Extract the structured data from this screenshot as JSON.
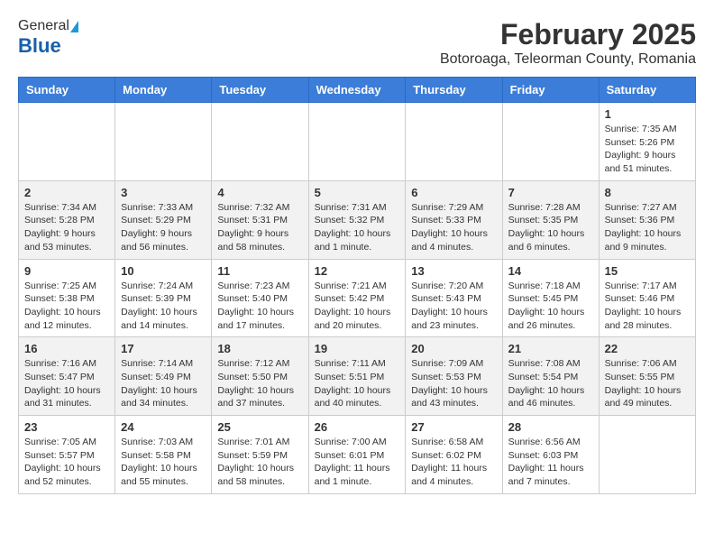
{
  "header": {
    "logo_general": "General",
    "logo_blue": "Blue",
    "main_title": "February 2025",
    "subtitle": "Botoroaga, Teleorman County, Romania"
  },
  "calendar": {
    "days_of_week": [
      "Sunday",
      "Monday",
      "Tuesday",
      "Wednesday",
      "Thursday",
      "Friday",
      "Saturday"
    ],
    "weeks": [
      [
        {
          "day": "",
          "info": ""
        },
        {
          "day": "",
          "info": ""
        },
        {
          "day": "",
          "info": ""
        },
        {
          "day": "",
          "info": ""
        },
        {
          "day": "",
          "info": ""
        },
        {
          "day": "",
          "info": ""
        },
        {
          "day": "1",
          "info": "Sunrise: 7:35 AM\nSunset: 5:26 PM\nDaylight: 9 hours\nand 51 minutes."
        }
      ],
      [
        {
          "day": "2",
          "info": "Sunrise: 7:34 AM\nSunset: 5:28 PM\nDaylight: 9 hours\nand 53 minutes."
        },
        {
          "day": "3",
          "info": "Sunrise: 7:33 AM\nSunset: 5:29 PM\nDaylight: 9 hours\nand 56 minutes."
        },
        {
          "day": "4",
          "info": "Sunrise: 7:32 AM\nSunset: 5:31 PM\nDaylight: 9 hours\nand 58 minutes."
        },
        {
          "day": "5",
          "info": "Sunrise: 7:31 AM\nSunset: 5:32 PM\nDaylight: 10 hours\nand 1 minute."
        },
        {
          "day": "6",
          "info": "Sunrise: 7:29 AM\nSunset: 5:33 PM\nDaylight: 10 hours\nand 4 minutes."
        },
        {
          "day": "7",
          "info": "Sunrise: 7:28 AM\nSunset: 5:35 PM\nDaylight: 10 hours\nand 6 minutes."
        },
        {
          "day": "8",
          "info": "Sunrise: 7:27 AM\nSunset: 5:36 PM\nDaylight: 10 hours\nand 9 minutes."
        }
      ],
      [
        {
          "day": "9",
          "info": "Sunrise: 7:25 AM\nSunset: 5:38 PM\nDaylight: 10 hours\nand 12 minutes."
        },
        {
          "day": "10",
          "info": "Sunrise: 7:24 AM\nSunset: 5:39 PM\nDaylight: 10 hours\nand 14 minutes."
        },
        {
          "day": "11",
          "info": "Sunrise: 7:23 AM\nSunset: 5:40 PM\nDaylight: 10 hours\nand 17 minutes."
        },
        {
          "day": "12",
          "info": "Sunrise: 7:21 AM\nSunset: 5:42 PM\nDaylight: 10 hours\nand 20 minutes."
        },
        {
          "day": "13",
          "info": "Sunrise: 7:20 AM\nSunset: 5:43 PM\nDaylight: 10 hours\nand 23 minutes."
        },
        {
          "day": "14",
          "info": "Sunrise: 7:18 AM\nSunset: 5:45 PM\nDaylight: 10 hours\nand 26 minutes."
        },
        {
          "day": "15",
          "info": "Sunrise: 7:17 AM\nSunset: 5:46 PM\nDaylight: 10 hours\nand 28 minutes."
        }
      ],
      [
        {
          "day": "16",
          "info": "Sunrise: 7:16 AM\nSunset: 5:47 PM\nDaylight: 10 hours\nand 31 minutes."
        },
        {
          "day": "17",
          "info": "Sunrise: 7:14 AM\nSunset: 5:49 PM\nDaylight: 10 hours\nand 34 minutes."
        },
        {
          "day": "18",
          "info": "Sunrise: 7:12 AM\nSunset: 5:50 PM\nDaylight: 10 hours\nand 37 minutes."
        },
        {
          "day": "19",
          "info": "Sunrise: 7:11 AM\nSunset: 5:51 PM\nDaylight: 10 hours\nand 40 minutes."
        },
        {
          "day": "20",
          "info": "Sunrise: 7:09 AM\nSunset: 5:53 PM\nDaylight: 10 hours\nand 43 minutes."
        },
        {
          "day": "21",
          "info": "Sunrise: 7:08 AM\nSunset: 5:54 PM\nDaylight: 10 hours\nand 46 minutes."
        },
        {
          "day": "22",
          "info": "Sunrise: 7:06 AM\nSunset: 5:55 PM\nDaylight: 10 hours\nand 49 minutes."
        }
      ],
      [
        {
          "day": "23",
          "info": "Sunrise: 7:05 AM\nSunset: 5:57 PM\nDaylight: 10 hours\nand 52 minutes."
        },
        {
          "day": "24",
          "info": "Sunrise: 7:03 AM\nSunset: 5:58 PM\nDaylight: 10 hours\nand 55 minutes."
        },
        {
          "day": "25",
          "info": "Sunrise: 7:01 AM\nSunset: 5:59 PM\nDaylight: 10 hours\nand 58 minutes."
        },
        {
          "day": "26",
          "info": "Sunrise: 7:00 AM\nSunset: 6:01 PM\nDaylight: 11 hours\nand 1 minute."
        },
        {
          "day": "27",
          "info": "Sunrise: 6:58 AM\nSunset: 6:02 PM\nDaylight: 11 hours\nand 4 minutes."
        },
        {
          "day": "28",
          "info": "Sunrise: 6:56 AM\nSunset: 6:03 PM\nDaylight: 11 hours\nand 7 minutes."
        },
        {
          "day": "",
          "info": ""
        }
      ]
    ]
  }
}
